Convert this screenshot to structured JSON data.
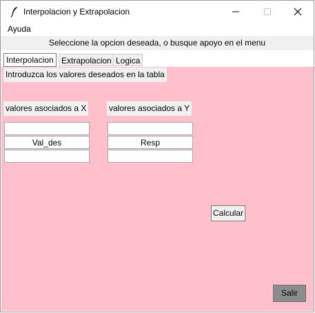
{
  "window": {
    "title": "Interpolacion y Extrapolacion",
    "controls": {
      "minimize": "minimize",
      "maximize": "maximize",
      "close": "close"
    }
  },
  "menu": {
    "items": [
      {
        "label": "Ayuda"
      }
    ]
  },
  "banner": {
    "text": "Seleccione la opcion deseada, o busque apoyo en el menu"
  },
  "tabs": [
    {
      "label": "Interpolacion",
      "selected": true
    },
    {
      "label": "Extrapolacion",
      "selected": false
    },
    {
      "label": "Logica",
      "selected": false
    }
  ],
  "panel": {
    "instruction": "Introduzca los valores deseados en la tabla",
    "x_header": "valores asociados a X",
    "y_header": "valores asociados a Y",
    "x_inputs": [
      "",
      "Val_des",
      ""
    ],
    "y_inputs": [
      "",
      "Resp",
      ""
    ],
    "calc_button": "Calcular",
    "exit_button": "Salir",
    "background_color": "#ffc0cb"
  },
  "icons": {
    "app": "feather-icon",
    "minimize": "minimize-icon",
    "maximize": "maximize-icon",
    "close": "close-icon"
  }
}
